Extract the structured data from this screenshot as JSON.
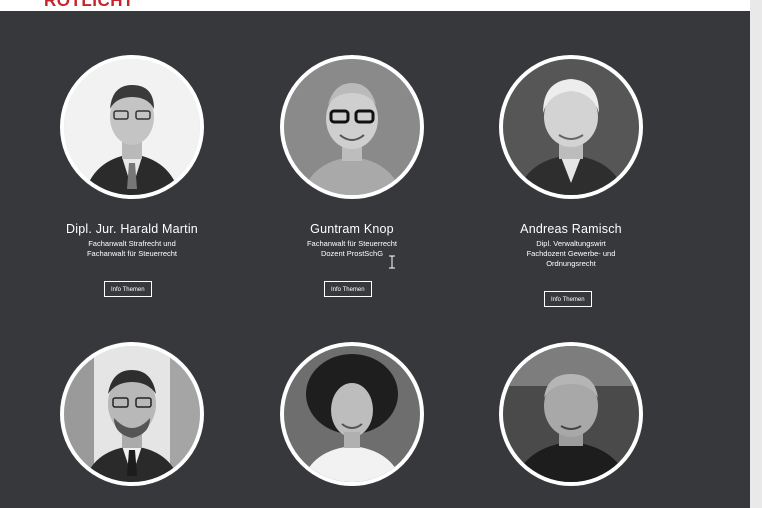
{
  "header": {
    "logo_text": "ROTLICHT",
    "brand_color": "#c8232c"
  },
  "page": {
    "background": "#36383c"
  },
  "team": [
    {
      "name": "Dipl. Jur. Harald Martin",
      "role_lines": [
        "Fachanwalt Strafrecht und",
        "Fachanwalt für Steuerrecht"
      ],
      "button": "Info Themen"
    },
    {
      "name": "Guntram Knop",
      "role_lines": [
        "Fachanwalt für Steuerrecht",
        "Dozent ProstSchG"
      ],
      "button": "Info Themen"
    },
    {
      "name": "Andreas Ramisch",
      "role_lines": [
        "Dipl. Verwaltungswirt",
        "Fachdozent Gewerbe- und",
        "Ordnungsrecht"
      ],
      "button": "Info Themen"
    },
    {
      "name": "",
      "role_lines": [],
      "button": ""
    },
    {
      "name": "",
      "role_lines": [],
      "button": ""
    },
    {
      "name": "",
      "role_lines": [],
      "button": ""
    }
  ],
  "icons": {
    "cursor": "text-cursor-icon",
    "scrollbar": "scrollbar"
  }
}
